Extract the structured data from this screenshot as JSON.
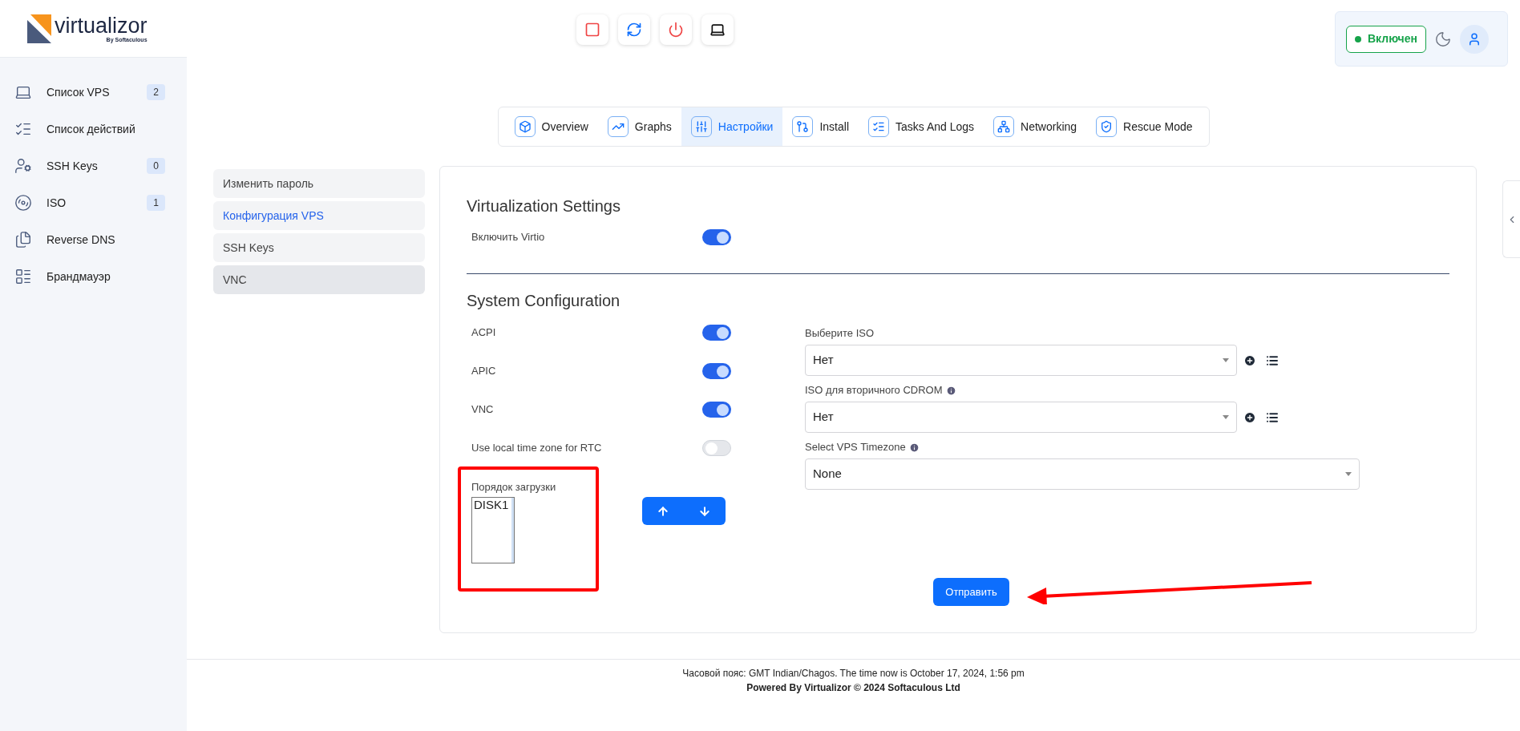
{
  "logo": {
    "name": "virtualizor",
    "tagline": "By Softaculous"
  },
  "sidebar": {
    "items": [
      {
        "kind": "laptop",
        "label": "Список VPS",
        "badge": "2"
      },
      {
        "kind": "checklist",
        "label": "Список действий"
      },
      {
        "kind": "user-shield",
        "label": "SSH Keys",
        "badge": "0"
      },
      {
        "kind": "disc",
        "label": "ISO",
        "badge": "1"
      },
      {
        "kind": "files",
        "label": "Reverse DNS"
      },
      {
        "kind": "firewall",
        "label": "Брандмауэр"
      }
    ]
  },
  "header": {
    "actions": [
      {
        "kind": "stop"
      },
      {
        "kind": "restart"
      },
      {
        "kind": "power"
      },
      {
        "kind": "console"
      }
    ],
    "status": {
      "label": "Включен",
      "color": "#16a34a"
    }
  },
  "tabs": [
    {
      "kind": "overview",
      "label": "Overview",
      "selected": false
    },
    {
      "kind": "graphs",
      "label": "Graphs",
      "selected": false
    },
    {
      "kind": "settings",
      "label": "Настройки",
      "selected": true
    },
    {
      "kind": "install",
      "label": "Install",
      "selected": false
    },
    {
      "kind": "tasks",
      "label": "Tasks And Logs",
      "selected": false
    },
    {
      "kind": "network",
      "label": "Networking",
      "selected": false
    },
    {
      "kind": "rescue",
      "label": "Rescue Mode",
      "selected": false
    }
  ],
  "settings_menu": [
    {
      "label": "Изменить пароль",
      "selected": false,
      "hovered": false
    },
    {
      "label": "Конфигурация VPS",
      "selected": true,
      "hovered": false
    },
    {
      "label": "SSH Keys",
      "selected": false,
      "hovered": false
    },
    {
      "label": "VNC",
      "selected": false,
      "hovered": true
    }
  ],
  "virtualization": {
    "title": "Virtualization Settings",
    "toggles": [
      {
        "label": "Включить Virtio",
        "on": true
      }
    ]
  },
  "system": {
    "title": "System Configuration",
    "toggles": [
      {
        "label": "ACPI",
        "on": true
      },
      {
        "label": "APIC",
        "on": true
      },
      {
        "label": "VNC",
        "on": true
      },
      {
        "label": "Use local time zone for RTC",
        "on": false
      }
    ],
    "boot_order": {
      "label": "Порядок загрузки",
      "options": [
        "DISK1"
      ]
    },
    "selects": [
      {
        "label": "Выберите ISO",
        "value": "Нет",
        "info": false,
        "actions": true
      },
      {
        "label": "ISO для вторичного CDROM",
        "value": "Нет",
        "info": true,
        "actions": true
      },
      {
        "label": "Select VPS Timezone",
        "value": "None",
        "info": true,
        "actions": false
      }
    ],
    "submit": "Отправить"
  },
  "footer": {
    "timezone": "Часовой пояс: GMT Indian/Chagos. The time now is October 17, 2024, 1:56 pm",
    "powered": "Powered By Virtualizor © 2024 Softaculous Ltd"
  }
}
